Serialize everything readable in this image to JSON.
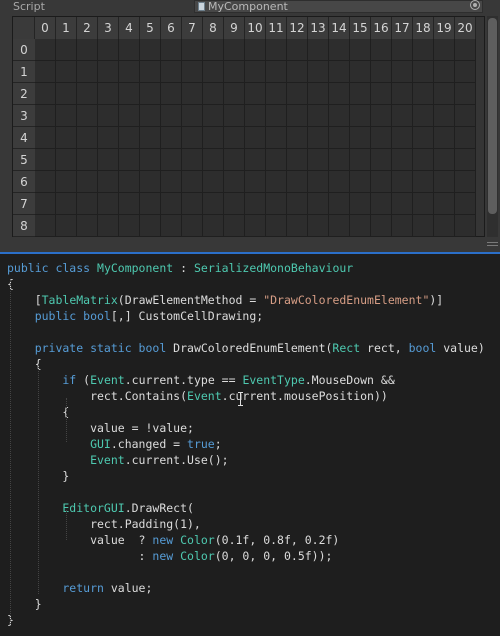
{
  "inspector": {
    "script_label": "Script",
    "script_value": "MyComponent",
    "columns": [
      "0",
      "1",
      "2",
      "3",
      "4",
      "5",
      "6",
      "7",
      "8",
      "9",
      "10",
      "11",
      "12",
      "13",
      "14",
      "15",
      "16",
      "17",
      "18",
      "19",
      "20"
    ],
    "rows": [
      "0",
      "1",
      "2",
      "3",
      "4",
      "5",
      "6",
      "7",
      "8"
    ]
  },
  "code": {
    "lines": [
      [
        [
          "kw",
          "public class "
        ],
        [
          "ty",
          "MyComponent"
        ],
        [
          "pl",
          " : "
        ],
        [
          "ty",
          "SerializedMonoBehaviour"
        ]
      ],
      [
        [
          "pl",
          "{"
        ]
      ],
      [
        [
          "pl",
          "    ["
        ],
        [
          "ty",
          "TableMatrix"
        ],
        [
          "pl",
          "(DrawElementMethod = "
        ],
        [
          "st",
          "\"DrawColoredEnumElement\""
        ],
        [
          "pl",
          ")]"
        ]
      ],
      [
        [
          "kw",
          "    public bool"
        ],
        [
          "pl",
          "[,] CustomCellDrawing;"
        ]
      ],
      [
        [
          "pl",
          ""
        ]
      ],
      [
        [
          "kw",
          "    private static bool "
        ],
        [
          "pl",
          "DrawColoredEnumElement("
        ],
        [
          "ty",
          "Rect"
        ],
        [
          "pl",
          " rect, "
        ],
        [
          "kw",
          "bool"
        ],
        [
          "pl",
          " value)"
        ]
      ],
      [
        [
          "pl",
          "    {"
        ]
      ],
      [
        [
          "kw",
          "        if "
        ],
        [
          "pl",
          "("
        ],
        [
          "ty",
          "Event"
        ],
        [
          "pl",
          ".current.type == "
        ],
        [
          "ty",
          "EventType"
        ],
        [
          "pl",
          ".MouseDown &&"
        ]
      ],
      [
        [
          "pl",
          "            rect.Contains("
        ],
        [
          "ty",
          "Event"
        ],
        [
          "pl",
          ".current.mousePosition))"
        ]
      ],
      [
        [
          "pl",
          "        {"
        ]
      ],
      [
        [
          "pl",
          "            value = !value;"
        ]
      ],
      [
        [
          "ty",
          "            GUI"
        ],
        [
          "pl",
          ".changed = "
        ],
        [
          "kw",
          "true"
        ],
        [
          "pl",
          ";"
        ]
      ],
      [
        [
          "ty",
          "            Event"
        ],
        [
          "pl",
          ".current.Use();"
        ]
      ],
      [
        [
          "pl",
          "        }"
        ]
      ],
      [
        [
          "pl",
          ""
        ]
      ],
      [
        [
          "ty",
          "        EditorGUI"
        ],
        [
          "pl",
          ".DrawRect("
        ]
      ],
      [
        [
          "pl",
          "            rect.Padding(1),"
        ]
      ],
      [
        [
          "pl",
          "            value  ? "
        ],
        [
          "kw",
          "new "
        ],
        [
          "ty",
          "Color"
        ],
        [
          "pl",
          "(0.1f, 0.8f, 0.2f)"
        ]
      ],
      [
        [
          "pl",
          "                   : "
        ],
        [
          "kw",
          "new "
        ],
        [
          "ty",
          "Color"
        ],
        [
          "pl",
          "(0, 0, 0, 0.5f));"
        ]
      ],
      [
        [
          "pl",
          ""
        ]
      ],
      [
        [
          "kw",
          "        return "
        ],
        [
          "pl",
          "value;"
        ]
      ],
      [
        [
          "pl",
          "    }"
        ]
      ],
      [
        [
          "pl",
          "}"
        ]
      ]
    ]
  }
}
